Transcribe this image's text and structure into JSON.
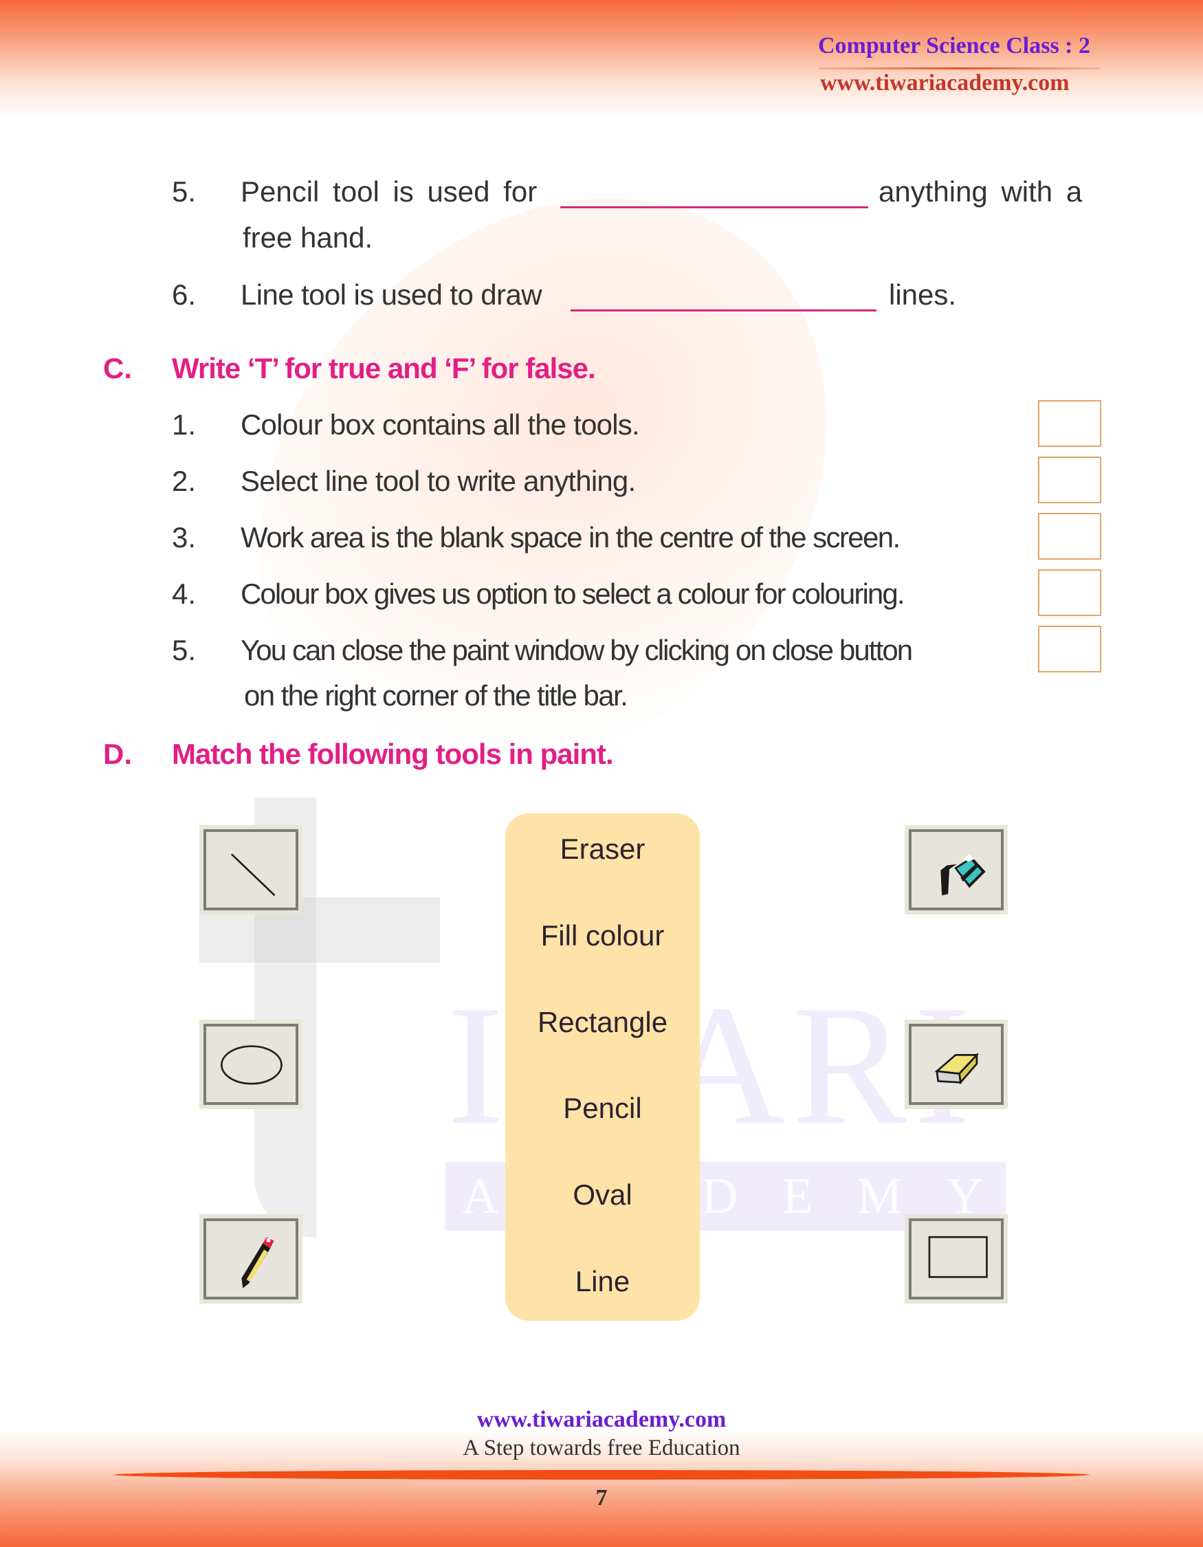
{
  "header": {
    "title": "Computer Science Class : 2",
    "url": "www.tiwariacademy.com"
  },
  "watermark": {
    "word1": "IWARI",
    "word2": "ACADEMY"
  },
  "fill_blanks": [
    {
      "number": "5.",
      "before": "Pencil tool is used for",
      "after": "anything with a",
      "continuation": "free hand."
    },
    {
      "number": "6.",
      "before": "Line tool is used to draw",
      "after": "lines."
    }
  ],
  "section_c": {
    "letter": "C.",
    "title": "Write ‘T’ for true and ‘F’ for false.",
    "items": [
      {
        "number": "1.",
        "text": "Colour box contains all the tools.",
        "answer": ""
      },
      {
        "number": "2.",
        "text": "Select line tool to write anything.",
        "answer": ""
      },
      {
        "number": "3.",
        "text": "Work area is the blank space in the centre of the screen.",
        "answer": ""
      },
      {
        "number": "4.",
        "text": "Colour box gives us option to select a colour for colouring.",
        "answer": ""
      },
      {
        "number": "5.",
        "text": "You can close the paint window by clicking on close button",
        "continuation": "on the right corner of the title bar.",
        "answer": ""
      }
    ]
  },
  "section_d": {
    "letter": "D.",
    "title": "Match the following tools in paint.",
    "left_icons": [
      "line-tool-icon",
      "oval-tool-icon",
      "pencil-tool-icon"
    ],
    "right_icons": [
      "fill-colour-tool-icon",
      "eraser-tool-icon",
      "rectangle-tool-icon"
    ],
    "labels": [
      "Eraser",
      "Fill colour",
      "Rectangle",
      "Pencil",
      "Oval",
      "Line"
    ]
  },
  "footer": {
    "url": "www.tiwariacademy.com",
    "tagline": "A Step towards free Education",
    "page_number": "7"
  },
  "colors": {
    "heading": "#e21f85",
    "header_title": "#6a1fd0",
    "header_url": "#c0392b",
    "blank_line": "#d6297a",
    "answer_box": "#e3a56c",
    "label_pill": "#fde3a7"
  }
}
